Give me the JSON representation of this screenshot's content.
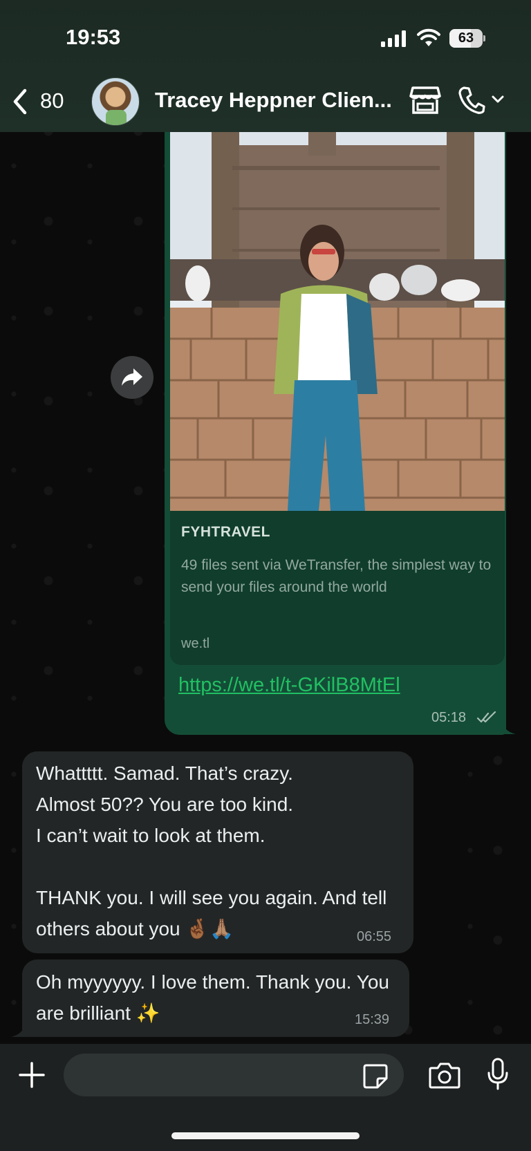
{
  "status_bar": {
    "time": "19:53",
    "battery_percent": "63"
  },
  "header": {
    "back_count": "80",
    "contact_name": "Tracey Heppner Clien..."
  },
  "messages": {
    "outgoing_link": {
      "preview_site": "FYHTRAVEL",
      "preview_description": "49 files sent via WeTransfer, the simplest way to send your files around the world",
      "preview_domain": "we.tl",
      "url": "https://we.tl/t-GKilB8MtEl",
      "time": "05:18",
      "status": "read"
    },
    "incoming": [
      {
        "text": "Whattttt. Samad. That’s crazy.\nAlmost 50?? You are too kind.\nI can’t wait to look at them.\n\nTHANK you. I will see you again. And tell others about you 🤞🏾🙏🏽",
        "time": "06:55"
      },
      {
        "text": "Oh myyyyyy. I love them. Thank you. You are brilliant ✨",
        "time": "15:39"
      }
    ]
  },
  "composer": {
    "input_value": "",
    "icons": [
      "plus-icon",
      "sticker-icon",
      "camera-icon",
      "microphone-icon"
    ]
  },
  "colors": {
    "outgoing_bubble": "#144d37",
    "incoming_bubble": "#232626",
    "link": "#21c063",
    "header_bg": "#1f3028"
  }
}
